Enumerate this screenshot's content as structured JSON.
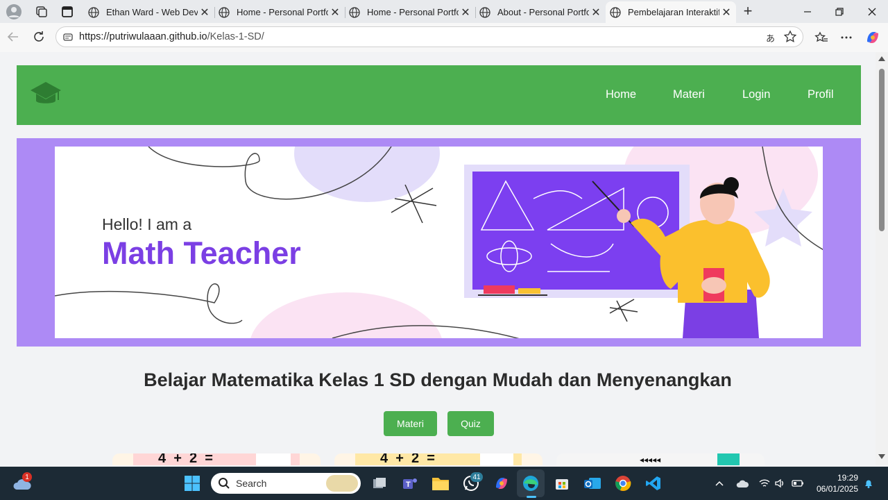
{
  "browser": {
    "tabs": [
      {
        "title": "Ethan Ward - Web Deve"
      },
      {
        "title": "Home - Personal Portfol"
      },
      {
        "title": "Home - Personal Portfol"
      },
      {
        "title": "About - Personal Portfol"
      },
      {
        "title": "Pembelajaran Interaktif"
      }
    ],
    "new_tab": "+",
    "url_host": "https://putriwulaaan.github.io",
    "url_path": "/Kelas-1-SD/"
  },
  "page": {
    "nav": [
      "Home",
      "Materi",
      "Login",
      "Profil"
    ],
    "banner": {
      "line1": "Hello! I am a",
      "line2": "Math Teacher"
    },
    "heading": "Belajar Matematika Kelas 1 SD dengan Mudah dan Menyenangkan",
    "buttons": {
      "materi": "Materi",
      "quiz": "Quiz"
    },
    "cards": [
      {
        "text": "4  +  2  ="
      },
      {
        "text": "4  +  2  ="
      },
      {
        "text": "◂◂◂◂◂"
      }
    ]
  },
  "taskbar": {
    "search_placeholder": "Search",
    "weather_badge": "1",
    "whatsapp_badge": "41",
    "time": "19:29",
    "date": "06/01/2025"
  },
  "colors": {
    "header": "#4caf50",
    "banner": "#ad8af5",
    "accent_purple": "#7b3fe4"
  }
}
